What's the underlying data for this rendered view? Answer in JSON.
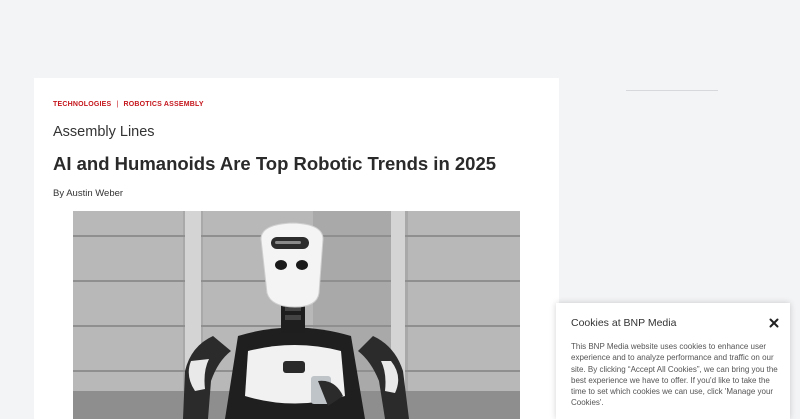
{
  "article": {
    "tags": [
      "TECHNOLOGIES",
      "ROBOTICS ASSEMBLY"
    ],
    "tag_separator": "|",
    "section": "Assembly Lines",
    "title": "AI and Humanoids Are Top Robotic Trends in 2025",
    "byline": "By Austin Weber"
  },
  "cookie_banner": {
    "title": "Cookies at BNP Media",
    "close_icon": "close-icon",
    "body": "This BNP Media website uses cookies to enhance user experience and to analyze performance and traffic on our site. By clicking “Accept All Cookies”, we can bring you the best experience we have to offer. If you'd like to take the time to set which cookies we can use, click 'Manage your Cookies'."
  },
  "colors": {
    "tag": "#c4161c",
    "page_background": "#f3f4f6",
    "card_background": "#ffffff"
  }
}
